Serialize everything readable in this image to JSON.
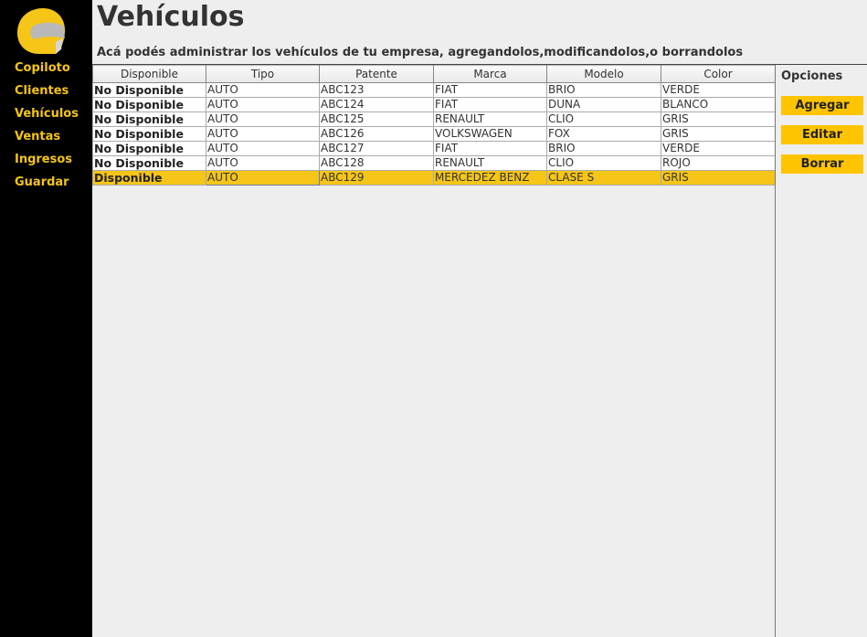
{
  "sidebar": {
    "logo_icon": "helmet-icon",
    "items": [
      "Copiloto",
      "Clientes",
      "Vehículos",
      "Ventas",
      "Ingresos",
      "Guardar"
    ]
  },
  "header": {
    "title": "Vehículos",
    "subtitle": "Acá podés administrar los vehículos de tu empresa, agregandolos,modificandolos,o borrandolos"
  },
  "table": {
    "columns": [
      "Disponible",
      "Tipo",
      "Patente",
      "Marca",
      "Modelo",
      "Color"
    ],
    "rows": [
      [
        "No Disponible",
        "AUTO",
        "ABC123",
        "FIAT",
        "BRIO",
        "VERDE"
      ],
      [
        "No Disponible",
        "AUTO",
        "ABC124",
        "FIAT",
        "DUNA",
        "BLANCO"
      ],
      [
        "No Disponible",
        "AUTO",
        "ABC125",
        "RENAULT",
        "CLIO",
        "GRIS"
      ],
      [
        "No Disponible",
        "AUTO",
        "ABC126",
        "VOLKSWAGEN",
        "FOX",
        "GRIS"
      ],
      [
        "No Disponible",
        "AUTO",
        "ABC127",
        "FIAT",
        "BRIO",
        "VERDE"
      ],
      [
        "No Disponible",
        "AUTO",
        "ABC128",
        "RENAULT",
        "CLIO",
        "ROJO"
      ],
      [
        "Disponible",
        "AUTO",
        "ABC129",
        "MERCEDEZ BENZ",
        "CLASE S",
        "GRIS"
      ]
    ],
    "selected_row": 6
  },
  "options": {
    "title": "Opciones",
    "add_label": "Agregar",
    "edit_label": "Editar",
    "delete_label": "Borrar"
  },
  "colors": {
    "accent": "#f5c518",
    "sidebar_bg": "#000000",
    "button_bg": "#ffc400"
  }
}
